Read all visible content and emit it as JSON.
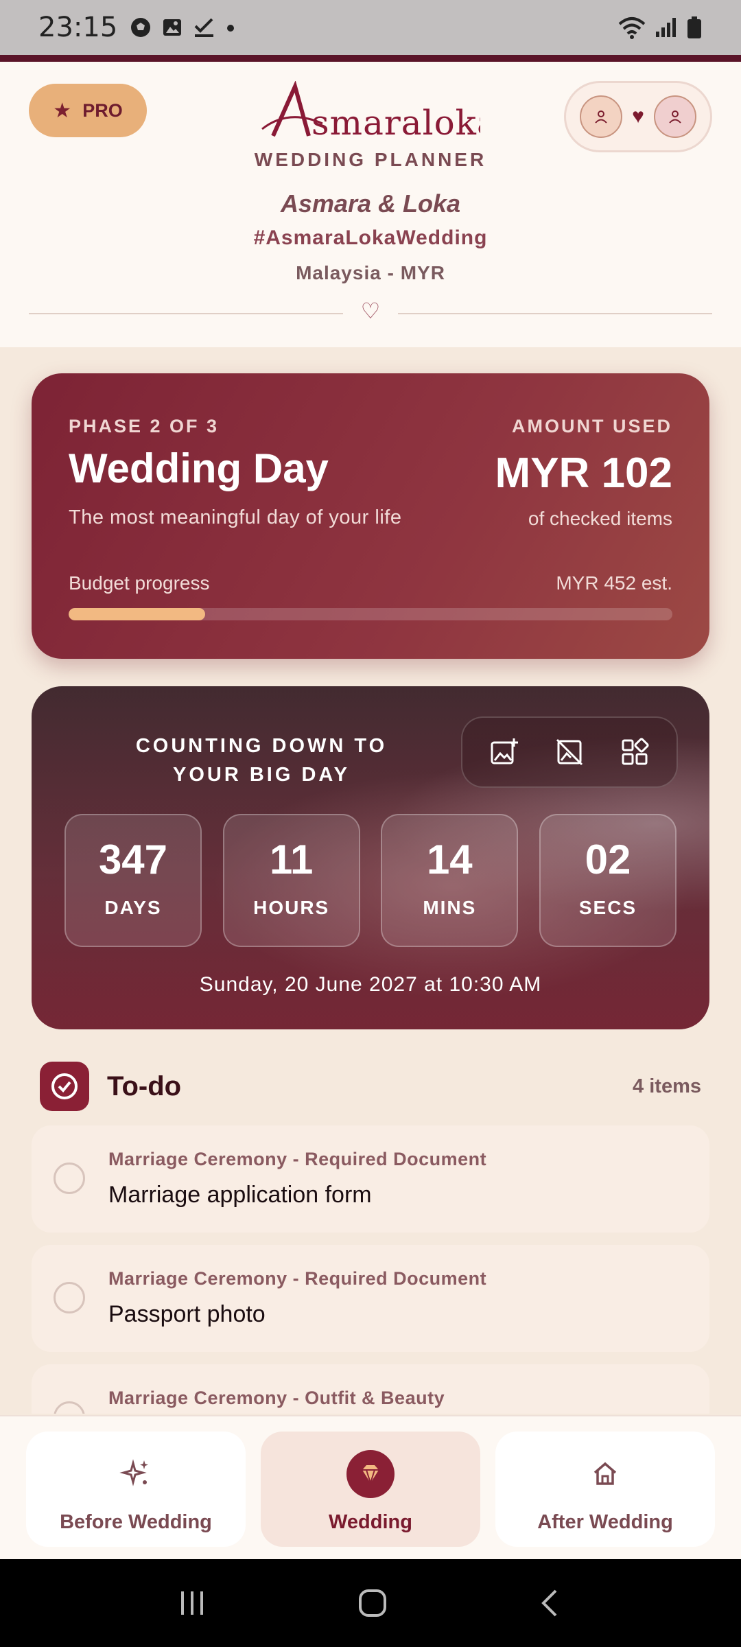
{
  "status_bar": {
    "time": "23:15"
  },
  "header": {
    "pro_label": "PRO",
    "logo_text": "Asmaraloka",
    "subtitle": "WEDDING PLANNER",
    "couple_names": "Asmara & Loka",
    "hashtag": "#AsmaraLokaWedding",
    "locale": "Malaysia - MYR"
  },
  "phase_card": {
    "phase_label": "PHASE 2 OF 3",
    "title": "Wedding Day",
    "description": "The most meaningful day of your life",
    "amount_label": "AMOUNT USED",
    "amount_value": "MYR 102",
    "amount_sub": "of checked items",
    "budget_label": "Budget progress",
    "budget_estimate": "MYR 452 est.",
    "budget_progress": 0.226
  },
  "countdown": {
    "heading": "COUNTING DOWN TO YOUR BIG DAY",
    "units": [
      {
        "value": "347",
        "label": "DAYS"
      },
      {
        "value": "11",
        "label": "HOURS"
      },
      {
        "value": "14",
        "label": "MINS"
      },
      {
        "value": "02",
        "label": "SECS"
      }
    ],
    "date_text": "Sunday, 20 June 2027 at 10:30 AM"
  },
  "todo": {
    "title": "To-do",
    "count": "4 items",
    "items": [
      {
        "category": "Marriage Ceremony - Required Document",
        "name": "Marriage application form"
      },
      {
        "category": "Marriage Ceremony - Required Document",
        "name": "Passport photo"
      },
      {
        "category": "Marriage Ceremony - Outfit & Beauty",
        "name": ""
      }
    ]
  },
  "bottom_nav": {
    "items": [
      {
        "label": "Before Wedding",
        "icon": "sparkle-icon"
      },
      {
        "label": "Wedding",
        "icon": "diamond-icon"
      },
      {
        "label": "After Wedding",
        "icon": "home-icon"
      }
    ],
    "active": "Wedding"
  },
  "colors": {
    "brand": "#8a2035",
    "accent": "#e8b07a",
    "progress": "#f2b982"
  }
}
